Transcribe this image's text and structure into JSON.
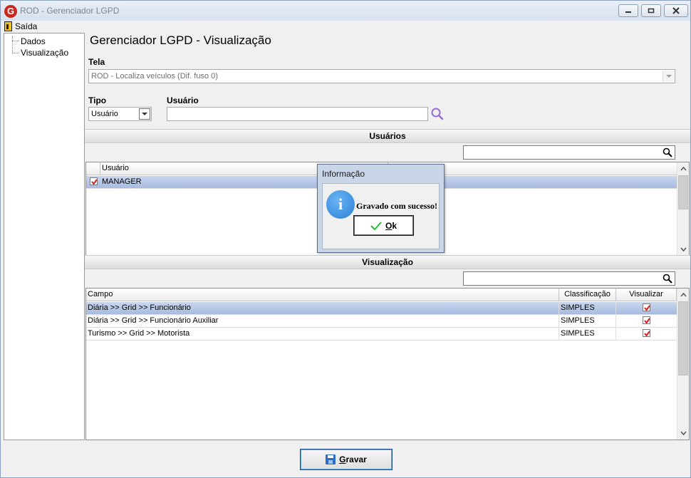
{
  "window": {
    "title": "ROD - Gerenciador LGPD",
    "logo_letter": "G"
  },
  "menu": {
    "exit_label": "Saída"
  },
  "tree": {
    "items": [
      "Dados",
      "Visualização"
    ]
  },
  "page": {
    "title": "Gerenciador LGPD - Visualização"
  },
  "form": {
    "tela_label": "Tela",
    "tela_value": "ROD - Localiza veículos (Dif. fuso 0)",
    "tipo_label": "Tipo",
    "tipo_value": "Usuário",
    "usuario_label": "Usuário",
    "usuario_value": ""
  },
  "users_section": {
    "header": "Usuários",
    "search_value": "",
    "columns": [
      "Usuário"
    ],
    "rows": [
      {
        "checked": true,
        "usuario": "MANAGER",
        "selected": true
      }
    ]
  },
  "visual_section": {
    "header": "Visualização",
    "search_value": "",
    "columns": [
      "Campo",
      "Classificação",
      "Visualizar"
    ],
    "rows": [
      {
        "campo": "Diária >> Grid >> Funcionário",
        "classificacao": "SIMPLES",
        "visualizar": true,
        "selected": true
      },
      {
        "campo": "Diária >> Grid >> Funcionário Auxiliar",
        "classificacao": "SIMPLES",
        "visualizar": true,
        "selected": false
      },
      {
        "campo": "Turismo >> Grid >> Motorista",
        "classificacao": "SIMPLES",
        "visualizar": true,
        "selected": false
      }
    ]
  },
  "dialog": {
    "title": "Informação",
    "message": "Gravado com sucesso!",
    "ok_accel": "O",
    "ok_rest": "k",
    "icon": "info-icon"
  },
  "footer": {
    "save_accel": "G",
    "save_rest": "ravar"
  },
  "colors": {
    "selection": "#b4c6e7",
    "check_red": "#d42020",
    "search_icon_purple": "#9a6bd0"
  }
}
